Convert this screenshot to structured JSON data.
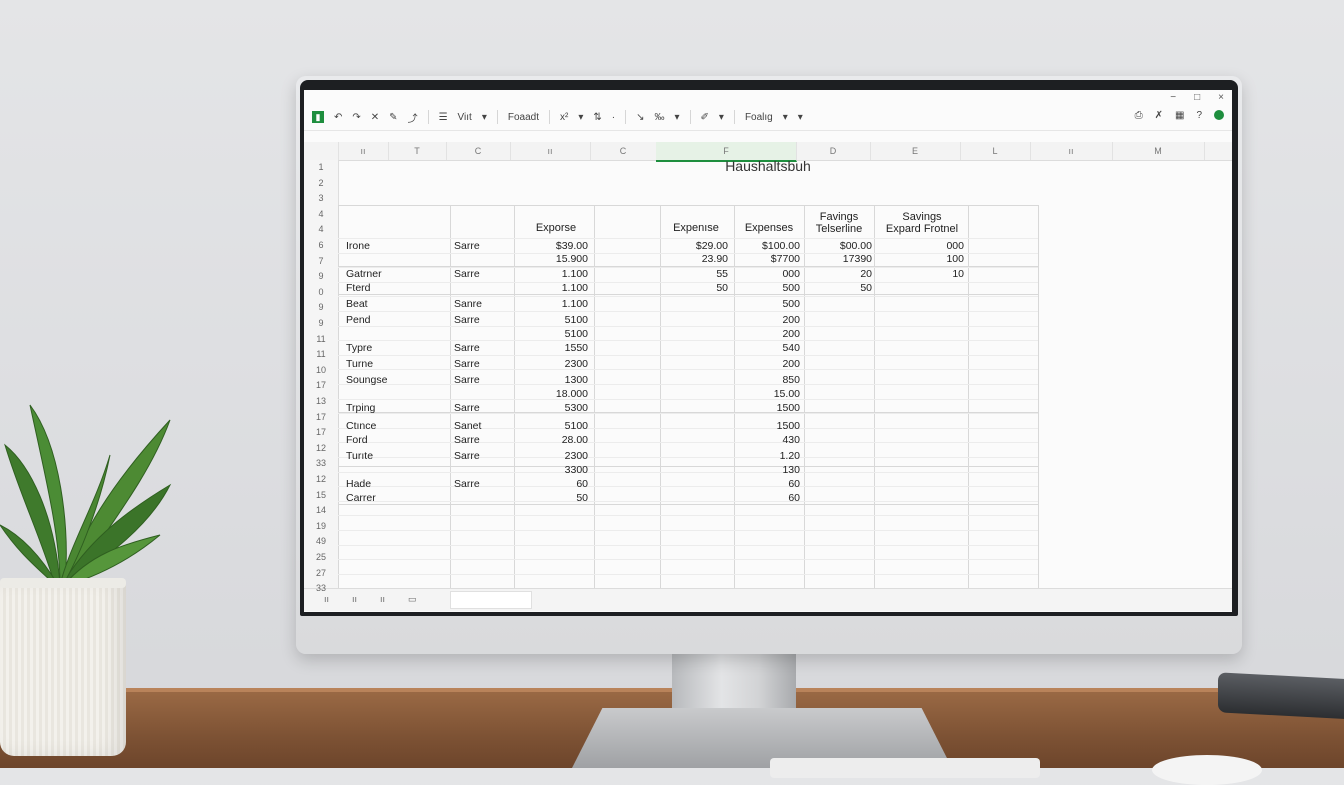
{
  "sheet": {
    "title": "Haushaltsbuh",
    "window_controls": [
      "−",
      "□",
      "×"
    ],
    "toolbar": {
      "undo_label": "↶",
      "redo_label": "↷",
      "clear_label": "✕",
      "paint_label": "✎",
      "link_label": "⤴",
      "view_label": "Viıt",
      "view_arrow": "▾",
      "font_label": "Foaadt",
      "size_label": "x²",
      "size_arrow": "▾",
      "format_label": "⇅",
      "format_arrow": "·",
      "wrap_label": "↘",
      "pct_label": "‰",
      "pct_arrow": "▾",
      "pen_label": "✐",
      "pen_arrow": "▾",
      "more_label": "Foalıg",
      "more_arrow1": "▾",
      "more_arrow2": "▾",
      "right_icons": [
        "⎙",
        "✗",
        "▦",
        "?"
      ]
    },
    "columns": [
      "ıı",
      "T",
      "C",
      "ıı",
      "C",
      "T",
      "F",
      "D",
      "E",
      "L",
      "ıı",
      "M"
    ],
    "row_numbers": [
      "1",
      "2",
      "3",
      "4",
      "4",
      "6",
      "7",
      "9",
      "0",
      "9",
      "9",
      "11",
      "11",
      "10",
      "17",
      "13",
      "17",
      "17",
      "12",
      "33",
      "12",
      "15",
      "14",
      "19",
      "49",
      "25",
      "27",
      "33"
    ],
    "headers": {
      "expense1": "Exporse",
      "expense2": "Expenıse",
      "expenses": "Expenses",
      "savings1_line1": "Favings",
      "savings1_line2": "Telserline",
      "savings2_line1": "Savings",
      "savings2_line2": "Expard Frotnel"
    },
    "rows": [
      {
        "name": "Irone",
        "type": "Sarre",
        "e1": [
          "$39.00",
          "15.900"
        ],
        "e2": [
          "$29.00",
          "23.90"
        ],
        "e3": [
          "$100.00",
          "$7700"
        ],
        "s1": [
          "$00.00",
          "17390"
        ],
        "s2": [
          "000",
          "100"
        ]
      },
      {
        "name": "Gatrner",
        "type": "Sarre",
        "e1": [
          "1.100"
        ],
        "e2": [
          "55"
        ],
        "e3": [
          "000"
        ],
        "s1": [
          "20"
        ],
        "s2": [
          "10"
        ]
      },
      {
        "name": "Fterd",
        "type": "",
        "e1": [
          "1.100"
        ],
        "e2": [
          "50"
        ],
        "e3": [
          "500"
        ],
        "s1": [
          "50"
        ],
        "s2": []
      },
      {
        "name": "Beat",
        "type": "Sanre",
        "e1": [
          "1.100"
        ],
        "e2": [],
        "e3": [
          "500"
        ],
        "s1": [],
        "s2": []
      },
      {
        "name": "Pend",
        "type": "Sarre",
        "e1": [
          "5100"
        ],
        "e2": [],
        "e3": [
          "200"
        ],
        "s1": [],
        "s2": []
      },
      {
        "name": "",
        "type": "",
        "e1": [
          "5100"
        ],
        "e2": [],
        "e3": [
          "200"
        ],
        "s1": [],
        "s2": []
      },
      {
        "name": "Typre",
        "type": "Sarre",
        "e1": [
          "1550"
        ],
        "e2": [],
        "e3": [
          "540"
        ],
        "s1": [],
        "s2": []
      },
      {
        "name": "Turne",
        "type": "Sarre",
        "e1": [
          "2300"
        ],
        "e2": [],
        "e3": [
          "200"
        ],
        "s1": [],
        "s2": []
      },
      {
        "name": "Soungse",
        "type": "Sarre",
        "e1": [
          "1300"
        ],
        "e2": [],
        "e3": [
          "850"
        ],
        "s1": [],
        "s2": []
      },
      {
        "name": "",
        "type": "",
        "e1": [
          "18.000"
        ],
        "e2": [],
        "e3": [
          "15.00"
        ],
        "s1": [],
        "s2": []
      },
      {
        "name": "Trping",
        "type": "Sarre",
        "e1": [
          "5300"
        ],
        "e2": [],
        "e3": [
          "1500"
        ],
        "s1": [],
        "s2": []
      },
      {
        "name": "Ctınce",
        "type": "Sanet",
        "e1": [
          "5100"
        ],
        "e2": [],
        "e3": [
          "1500"
        ],
        "s1": [],
        "s2": []
      },
      {
        "name": "Ford",
        "type": "Sarre",
        "e1": [
          "28.00"
        ],
        "e2": [],
        "e3": [
          "430"
        ],
        "s1": [],
        "s2": []
      },
      {
        "name": "Turıte",
        "type": "Sarre",
        "e1": [
          "2300"
        ],
        "e2": [],
        "e3": [
          "1.20"
        ],
        "s1": [],
        "s2": []
      },
      {
        "name": "",
        "type": "",
        "e1": [
          "3300"
        ],
        "e2": [],
        "e3": [
          "130"
        ],
        "s1": [],
        "s2": []
      },
      {
        "name": "Hade",
        "type": "Sarre",
        "e1": [
          "60"
        ],
        "e2": [],
        "e3": [
          "60"
        ],
        "s1": [],
        "s2": []
      },
      {
        "name": "Carrer",
        "type": "",
        "e1": [
          "50"
        ],
        "e2": [],
        "e3": [
          "60"
        ],
        "s1": [],
        "s2": []
      }
    ],
    "tabs": [
      "ıı",
      "ıı",
      "ıı",
      "▭"
    ]
  }
}
